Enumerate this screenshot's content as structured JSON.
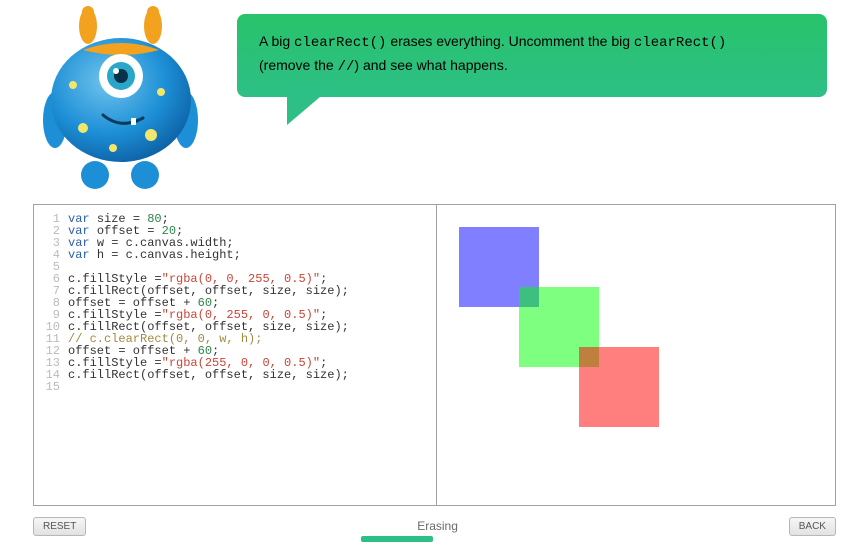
{
  "bubble": {
    "line1_a": "A big ",
    "line1_code": "clearRect()",
    "line1_b": " erases everything. Uncomment the big ",
    "line1_code2": "clearRect()",
    "line2_a": "(remove the ",
    "line2_code": "//",
    "line2_b": ") and see what happens."
  },
  "code_lines": [
    [
      {
        "t": "var ",
        "c": "kw"
      },
      {
        "t": "size = "
      },
      {
        "t": "80",
        "c": "num"
      },
      {
        "t": ";"
      }
    ],
    [
      {
        "t": "var ",
        "c": "kw"
      },
      {
        "t": "offset = "
      },
      {
        "t": "20",
        "c": "num"
      },
      {
        "t": ";"
      }
    ],
    [
      {
        "t": "var ",
        "c": "kw"
      },
      {
        "t": "w = c.canvas.width;"
      }
    ],
    [
      {
        "t": "var ",
        "c": "kw"
      },
      {
        "t": "h = c.canvas.height;"
      }
    ],
    [
      {
        "t": ""
      }
    ],
    [
      {
        "t": "c.fillStyle ="
      },
      {
        "t": "\"rgba(0, 0, 255, 0.5)\"",
        "c": "str"
      },
      {
        "t": ";"
      }
    ],
    [
      {
        "t": "c.fillRect(offset, offset, size, size);"
      }
    ],
    [
      {
        "t": "offset = offset + "
      },
      {
        "t": "60",
        "c": "num"
      },
      {
        "t": ";"
      }
    ],
    [
      {
        "t": "c.fillStyle ="
      },
      {
        "t": "\"rgba(0, 255, 0, 0.5)\"",
        "c": "str"
      },
      {
        "t": ";"
      }
    ],
    [
      {
        "t": "c.fillRect(offset, offset, size, size);"
      }
    ],
    [
      {
        "t": "// c.clearRect(0, 0, w, h);",
        "c": "cmt"
      }
    ],
    [
      {
        "t": "offset = offset + "
      },
      {
        "t": "60",
        "c": "num"
      },
      {
        "t": ";"
      }
    ],
    [
      {
        "t": "c.fillStyle ="
      },
      {
        "t": "\"rgba(255, 0, 0, 0.5)\"",
        "c": "str"
      },
      {
        "t": ";"
      }
    ],
    [
      {
        "t": "c.fillRect(offset, offset, size, size);"
      }
    ],
    [
      {
        "t": ""
      }
    ]
  ],
  "footer": {
    "reset": "RESET",
    "title": "Erasing",
    "back": "BACK"
  },
  "preview": {
    "squares": [
      {
        "color": "blue"
      },
      {
        "color": "green"
      },
      {
        "color": "red"
      }
    ]
  }
}
